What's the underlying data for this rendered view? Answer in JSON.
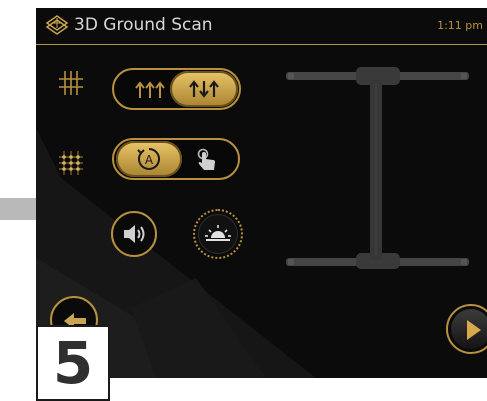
{
  "header": {
    "title": "3D Ground Scan",
    "time": "1:11 pm"
  },
  "settings": {
    "scan_mode": {
      "options": [
        "parallel-scan",
        "zigzag-scan"
      ],
      "selected": "zigzag-scan"
    },
    "control_mode": {
      "options": [
        "automatic",
        "manual"
      ],
      "selected": "automatic"
    },
    "auto_icon_letter": "A"
  },
  "step_number": "5",
  "colors": {
    "accent": "#b8913f",
    "background": "#0b0b0b",
    "text": "#d8d8d8"
  },
  "icons": [
    "ground-scan-logo-icon",
    "grid-lines-icon",
    "grid-points-icon",
    "parallel-arrows-icon",
    "zigzag-arrows-icon",
    "auto-mode-icon",
    "hand-touch-icon",
    "speaker-icon",
    "sunrise-brightness-icon",
    "back-arrow-icon",
    "play-icon",
    "probe-frame-image"
  ]
}
